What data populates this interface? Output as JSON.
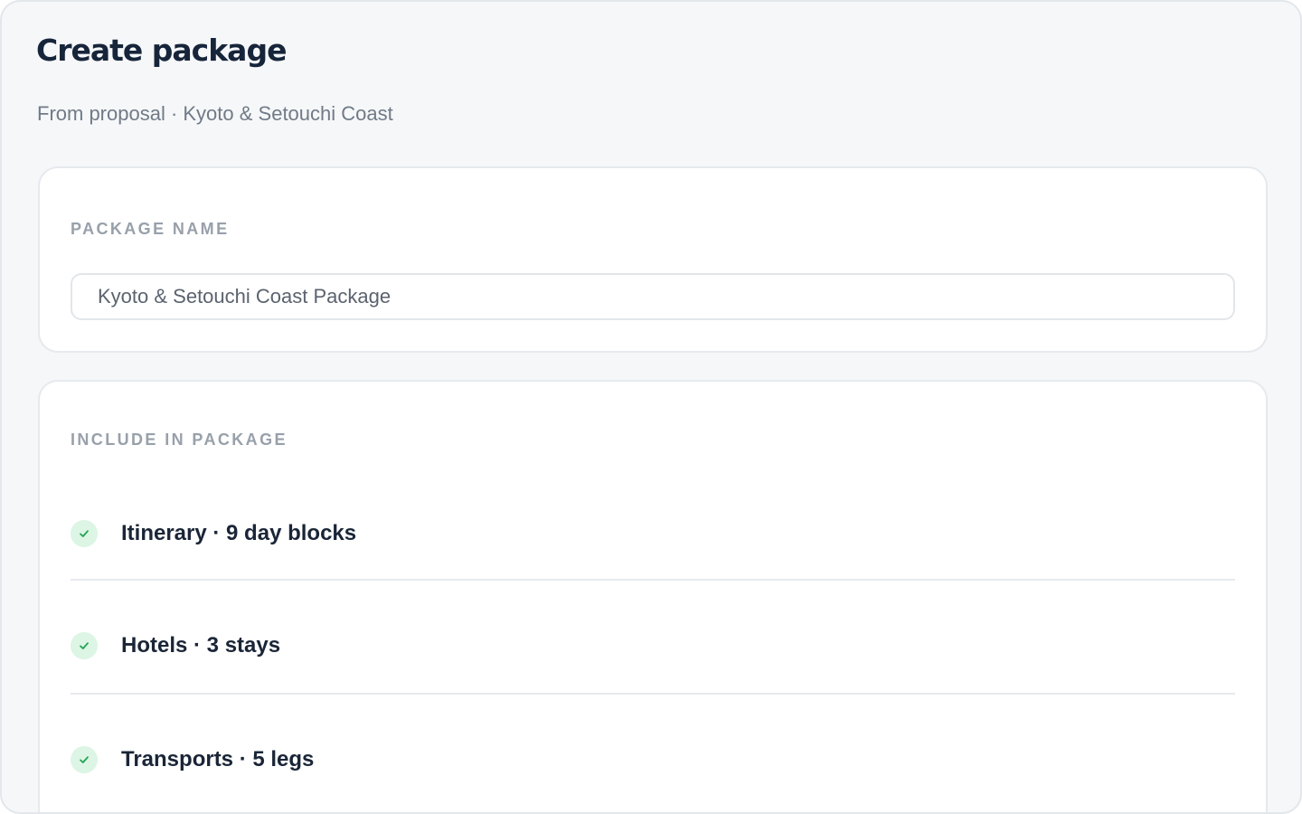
{
  "header": {
    "title": "Create package",
    "subtitle": "From proposal · Kyoto & Setouchi Coast"
  },
  "package_name": {
    "label": "PACKAGE NAME",
    "value": "Kyoto & Setouchi Coast Package"
  },
  "include": {
    "label": "INCLUDE IN PACKAGE",
    "items": [
      {
        "label": "Itinerary · 9 day blocks",
        "checked": true,
        "icon": "check-icon"
      },
      {
        "label": "Hotels · 3 stays",
        "checked": true,
        "icon": "check-icon"
      },
      {
        "label": "Transports · 5 legs",
        "checked": true,
        "icon": "check-icon"
      }
    ]
  },
  "colors": {
    "background": "#f5f7f9",
    "card": "#ffffff",
    "title": "#17253a",
    "muted": "#717a86",
    "label": "#98a0aa",
    "check_bg": "#dcf5e4",
    "check_mark": "#22a354"
  }
}
